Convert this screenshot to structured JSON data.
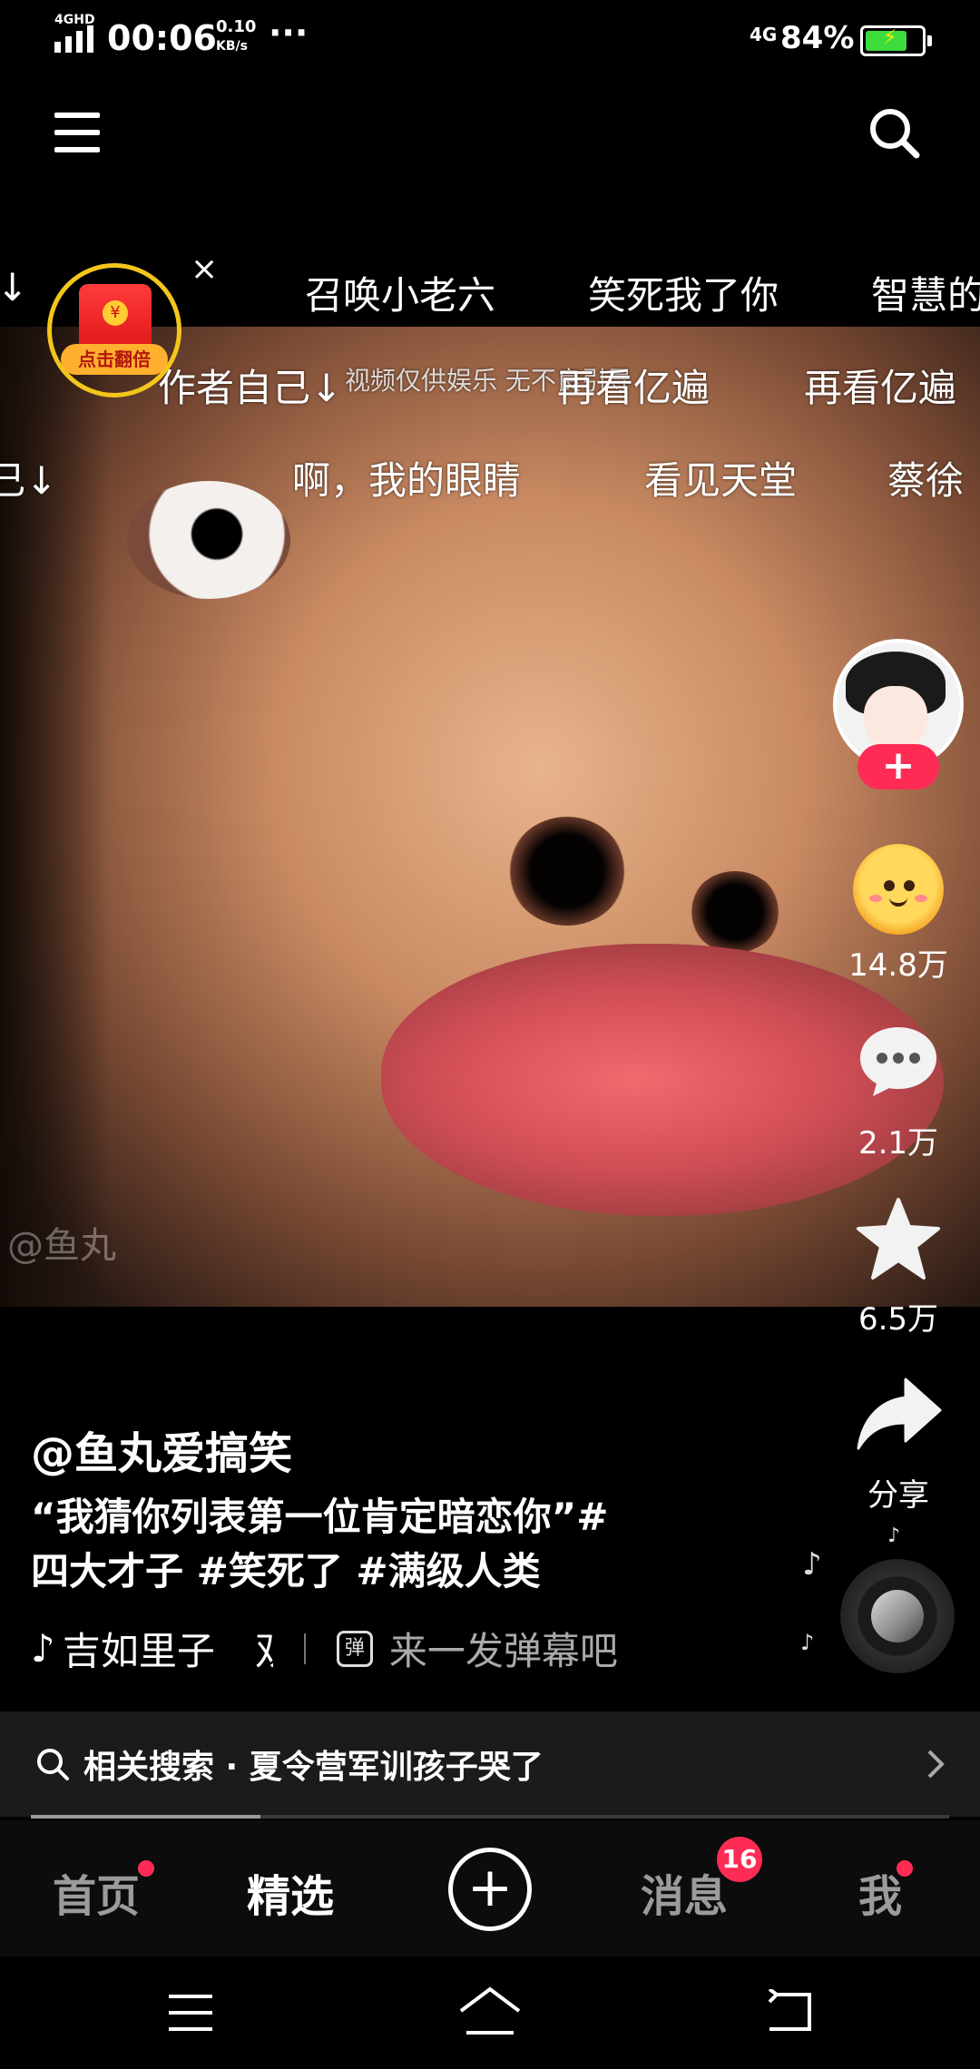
{
  "status_bar": {
    "network_type": "4GHD",
    "time": "00:06",
    "speed_value": "0.10",
    "speed_unit": "KB/s",
    "more": "···",
    "net_right": "4G",
    "battery": "84%",
    "battery_level": 0.84,
    "battery_color": "#3ddc3d"
  },
  "danmaku": {
    "row1": [
      "↓",
      "召唤小老六",
      "笑死我了你",
      "智慧的"
    ],
    "row2": [
      "作者自己↓",
      "视频仅供娱乐 无不良引导",
      "再看亿遍",
      "再看亿遍"
    ],
    "row3": [
      "己↓",
      "啊，我的眼睛",
      "看见天堂",
      "蔡徐"
    ]
  },
  "red_envelope": {
    "coin": "¥",
    "label": "点击翻倍",
    "close": "×"
  },
  "video": {
    "watermark": "@鱼丸"
  },
  "actions": {
    "follow": "+",
    "likes": "14.8万",
    "comments": "2.1万",
    "favorites": "6.5万",
    "share": "分享",
    "note": "♪"
  },
  "post": {
    "author": "@鱼丸爱搞笑",
    "caption_line1": "“我猜你列表第一位肯定暗恋你”#",
    "caption_line2": "四大才子 #笑死了 #满级人类",
    "music": "吉如里子",
    "music_tail": "双",
    "danmu_icon": "弹",
    "danmu_placeholder": "来一发弹幕吧"
  },
  "related": {
    "text": "相关搜索 · 夏令营军训孩子哭了",
    "progress": 0.25
  },
  "tabs": [
    {
      "label": "首页",
      "dot": true
    },
    {
      "label": "精选",
      "active": true
    },
    {
      "label": "消息",
      "badge": "16"
    },
    {
      "label": "我",
      "dot": true
    }
  ],
  "accent_color": "#fe2c55"
}
